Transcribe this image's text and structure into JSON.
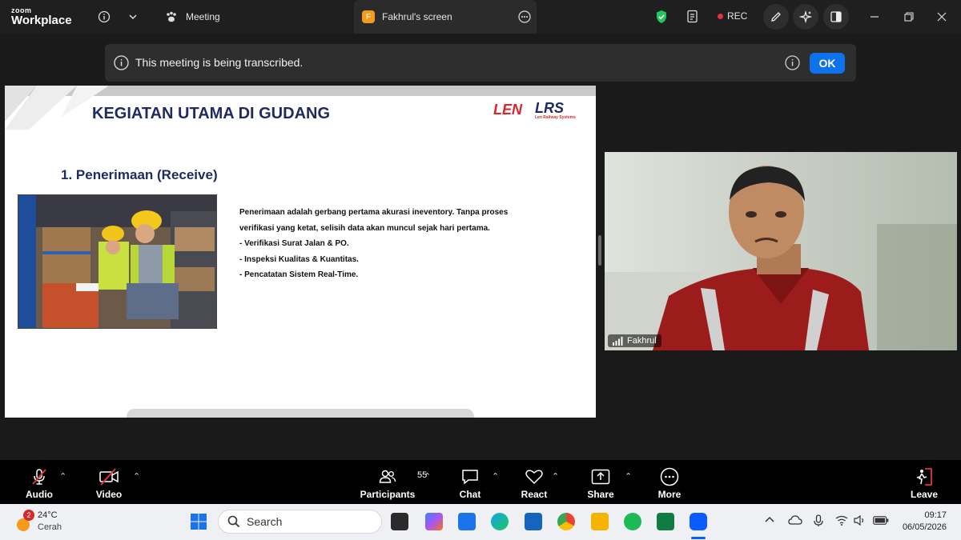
{
  "titlebar": {
    "logo_small": "zoom",
    "logo_big": "Workplace",
    "meeting_tab": "Meeting",
    "screen_tab": "Fakhrul's screen",
    "screen_tab_initial": "F",
    "rec_label": "REC"
  },
  "banner": {
    "message": "This meeting is being transcribed.",
    "ok_label": "OK"
  },
  "slide": {
    "title": "KEGIATAN UTAMA DI GUDANG",
    "subtitle": "1. Penerimaan (Receive)",
    "body_lines": [
      "Penerimaan adalah gerbang pertama akurasi ineventory. Tanpa proses",
      "verifikasi yang ketat, selisih data akan muncul sejak hari pertama.",
      "- Verifikasi Surat Jalan & PO.",
      "- Inspeksi Kualitas & Kuantitas.",
      "- Pencatatan Sistem Real-Time."
    ],
    "brand_left": "LEN",
    "brand_right": "LRS",
    "brand_right_caption": "Len Railway Systems"
  },
  "video": {
    "participant_name": "Fakhrul"
  },
  "toolbar": {
    "audio": "Audio",
    "video": "Video",
    "participants": "Participants",
    "participants_count": "55",
    "chat": "Chat",
    "react": "React",
    "share": "Share",
    "more": "More",
    "leave": "Leave"
  },
  "taskbar": {
    "weather_badge": "2",
    "temperature": "24°C",
    "condition": "Cerah",
    "search_placeholder": "Search",
    "time": "09:17",
    "date": "06/05/2026"
  },
  "colors": {
    "accent_blue": "#0e72ed",
    "rec_red": "#e5333b",
    "slide_title": "#1f2a5e",
    "shield_green": "#22c55e"
  }
}
